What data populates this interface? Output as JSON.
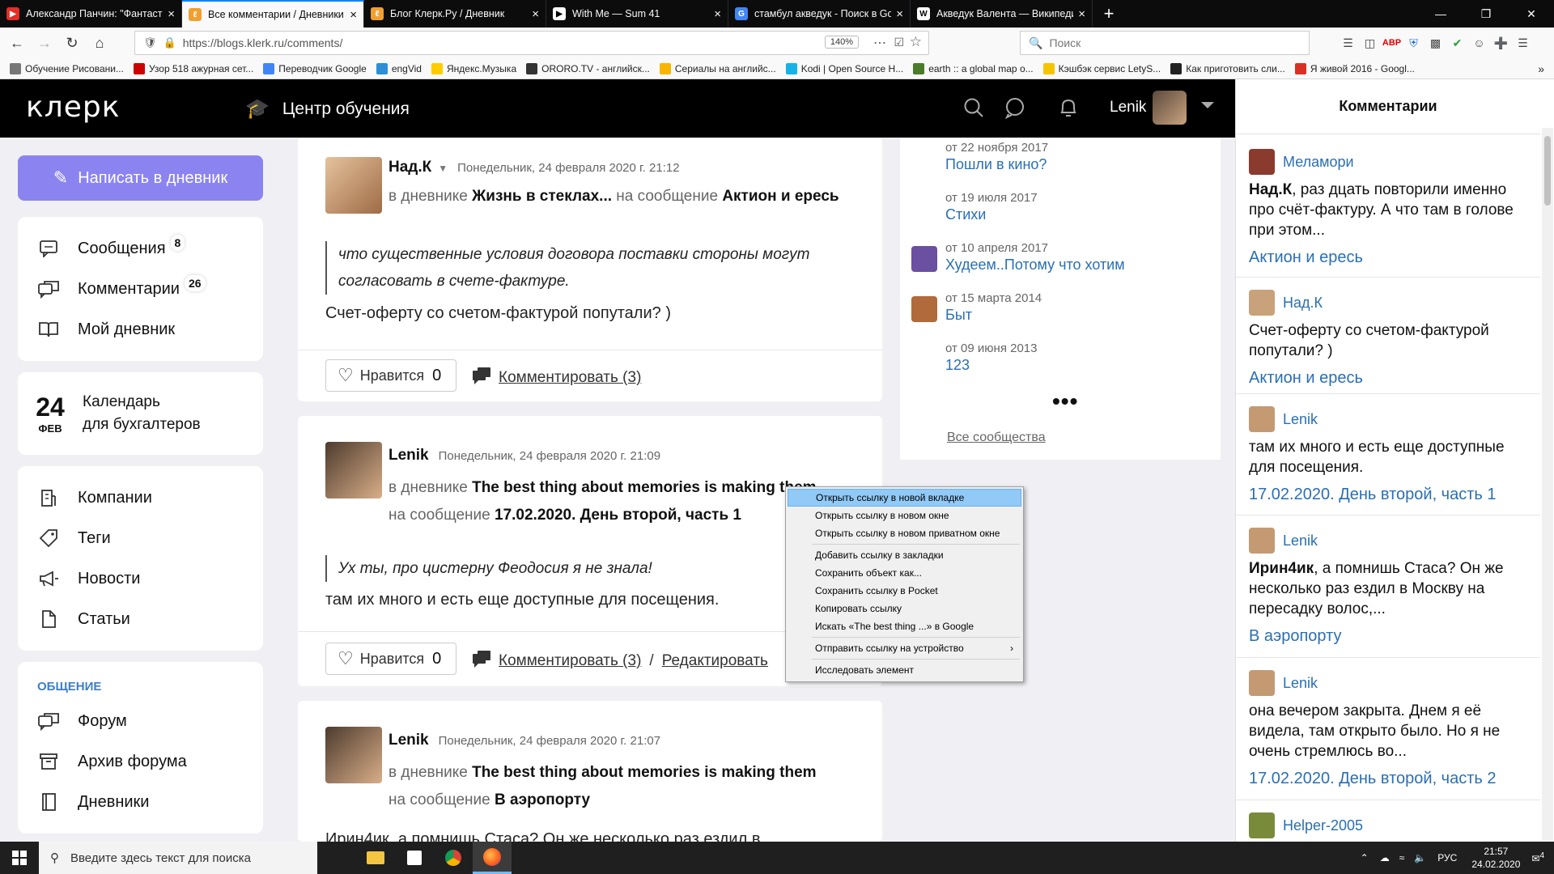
{
  "browser": {
    "tabs": [
      {
        "title": "Александр Панчин: \"Фантасти",
        "color": "#e52d27",
        "glyph": "▶"
      },
      {
        "title": "Все комментарии / Дневники",
        "color": "#f0a030",
        "glyph": "ℓ",
        "active": true
      },
      {
        "title": "Блог Клерк.Ру / Дневник",
        "color": "#f0a030",
        "glyph": "ℓ"
      },
      {
        "title": "With Me — Sum 41",
        "color": "#ffffff",
        "glyph": "▶"
      },
      {
        "title": "стамбул акведук - Поиск в Go",
        "color": "#4285f4",
        "glyph": "G"
      },
      {
        "title": "Акведук Валента — Википеди",
        "color": "#ffffff",
        "glyph": "W"
      }
    ],
    "new_tab": "+",
    "url": "https://blogs.klerk.ru/comments/",
    "url_host": "klerk.ru",
    "zoom": "140%",
    "search_placeholder": "Поиск",
    "bookmarks": [
      {
        "label": "Обучение Рисовани...",
        "color": "#777"
      },
      {
        "label": "Узор 518 ажурная сет...",
        "color": "#c00"
      },
      {
        "label": "Переводчик Google",
        "color": "#4285f4"
      },
      {
        "label": "engVid",
        "color": "#2d8fd5"
      },
      {
        "label": "Яндекс.Музыка",
        "color": "#fc0"
      },
      {
        "label": "ORORO.TV - английск...",
        "color": "#333"
      },
      {
        "label": "Сериалы на английс...",
        "color": "#f7b500"
      },
      {
        "label": "Kodi | Open Source H...",
        "color": "#17b2e7"
      },
      {
        "label": "earth :: a global map o...",
        "color": "#4a7c2a"
      },
      {
        "label": "Кэшбэк сервис LetyS...",
        "color": "#f5c400"
      },
      {
        "label": "Как приготовить сли...",
        "color": "#222"
      },
      {
        "label": "Я живой 2016 - Googl...",
        "color": "#d93025"
      }
    ]
  },
  "site": {
    "logo": "клерк",
    "center_title": "Центр обучения",
    "user_name": "Lenik"
  },
  "sidebar": {
    "write_button": "Написать в дневник",
    "menu1": [
      {
        "label": "Сообщения",
        "badge": "8",
        "icon": "message-icon"
      },
      {
        "label": "Комментарии",
        "badge": "26",
        "icon": "comments-icon"
      },
      {
        "label": "Мой дневник",
        "badge": "",
        "icon": "book-icon"
      }
    ],
    "calendar": {
      "day": "24",
      "month": "ФЕВ",
      "line1": "Календарь",
      "line2": "для бухгалтеров"
    },
    "menu2": [
      {
        "label": "Компании",
        "icon": "building-icon"
      },
      {
        "label": "Теги",
        "icon": "tag-icon"
      },
      {
        "label": "Новости",
        "icon": "megaphone-icon"
      },
      {
        "label": "Статьи",
        "icon": "document-icon"
      }
    ],
    "section_title": "ОБЩЕНИЕ",
    "menu3": [
      {
        "label": "Форум",
        "icon": "forum-icon"
      },
      {
        "label": "Архив форума",
        "icon": "archive-icon"
      },
      {
        "label": "Дневники",
        "icon": "diary-icon"
      }
    ]
  },
  "posts": [
    {
      "author": "Над.К",
      "date": "Понедельник, 24 февраля 2020 г. 21:12",
      "in_diary_label": "в дневнике",
      "diary": "Жизнь в стеклах...",
      "on_msg_label": "на сообщение",
      "message": "Актион и ересь",
      "quote": "что существенные условия договора поставки стороны могут согласовать в счете-фактуре.",
      "text": "Счет-оферту со счетом-фактурой попутали? )",
      "like_label": "Нравится",
      "likes": "0",
      "comment_label": "Комментировать (3)",
      "edit_label": ""
    },
    {
      "author": "Lenik",
      "date": "Понедельник, 24 февраля 2020 г. 21:09",
      "in_diary_label": "в дневнике",
      "diary": "The best thing about memories is making them",
      "on_msg_label": "на сообщение",
      "message": "17.02.2020. День второй, часть 1",
      "quote": "Ух ты, про цистерну Феодосия я не знала!",
      "text": "там их много и есть еще доступные для посещения.",
      "like_label": "Нравится",
      "likes": "0",
      "comment_label": "Комментировать (3)",
      "separator": "/",
      "edit_label": "Редактировать"
    },
    {
      "author": "Lenik",
      "date": "Понедельник, 24 февраля 2020 г. 21:07",
      "in_diary_label": "в дневнике",
      "diary": "The best thing about memories is making them",
      "on_msg_label": "на сообщение",
      "message": "В аэропорту",
      "text_partial": "Ирин4ик, а помнишь Стаса? Он же несколько раз ездил в"
    }
  ],
  "communities": {
    "items": [
      {
        "date": "от 22 ноября 2017",
        "title": "Пошли в кино?",
        "avatar": ""
      },
      {
        "date": "от 19 июля 2017",
        "title": "Стихи",
        "avatar": ""
      },
      {
        "date": "от 10 апреля 2017",
        "title": "Худеем..Потому что хотим",
        "avatar": "#6b4fa0"
      },
      {
        "date": "от 15 марта 2014",
        "title": "Быт",
        "avatar": "#b06a3b"
      },
      {
        "date": "от 09 июня 2013",
        "title": "123",
        "avatar": ""
      }
    ],
    "more": "•••",
    "all_link": "Все сообщества"
  },
  "right_panel": {
    "title": "Комментарии",
    "items": [
      {
        "author": "Меламори",
        "bold": "Над.К",
        "body": ", раз дцать повторили именно про счёт-фактуру. А что там в голове при этом...",
        "link": "Актион и ересь",
        "avatar": "#8a3b2e"
      },
      {
        "author": "Над.К",
        "bold": "",
        "body": "Счет-оферту со счетом-фактурой попутали? )",
        "link": "Актион и ересь",
        "avatar": "#c8a27a"
      },
      {
        "author": "Lenik",
        "bold": "",
        "body": "там их много и есть еще доступные для посещения.",
        "link": "17.02.2020. День второй, часть 1",
        "avatar": "#c49a73"
      },
      {
        "author": "Lenik",
        "bold": "Ирин4ик",
        "body": ", а помнишь Стаса? Он же несколько раз ездил в Москву на пересадку волос,...",
        "link": "В аэропорту",
        "avatar": "#c49a73"
      },
      {
        "author": "Lenik",
        "bold": "",
        "body": "она вечером закрыта. Днем я её видела, там открыто было. Но я не очень стремлюсь во...",
        "link": "17.02.2020. День второй, часть 2",
        "avatar": "#c49a73"
      },
      {
        "author": "Helper-2005",
        "bold": "",
        "body": "",
        "link": "",
        "avatar": "#7a8a3b"
      }
    ]
  },
  "context_menu": {
    "items": [
      {
        "label": "Открыть ссылку в новой вкладке",
        "highlight": true
      },
      {
        "label": "Открыть ссылку в новом окне"
      },
      {
        "label": "Открыть ссылку в новом приватном окне"
      },
      {
        "sep": true
      },
      {
        "label": "Добавить ссылку в закладки"
      },
      {
        "label": "Сохранить объект как..."
      },
      {
        "label": "Сохранить ссылку в Pocket"
      },
      {
        "label": "Копировать ссылку"
      },
      {
        "label": "Искать «The best thing ...» в Google"
      },
      {
        "sep": true
      },
      {
        "label": "Отправить ссылку на устройство",
        "submenu": true
      },
      {
        "sep": true
      },
      {
        "label": "Исследовать элемент"
      }
    ]
  },
  "taskbar": {
    "search_placeholder": "Введите здесь текст для поиска",
    "language": "РУС",
    "time": "21:57",
    "date": "24.02.2020",
    "notifications": "4"
  },
  "colors": {
    "accent_button": "#8b84f0",
    "link_blue": "#2a6fb4",
    "header_bg": "#000000",
    "context_highlight": "#91c9f7"
  }
}
